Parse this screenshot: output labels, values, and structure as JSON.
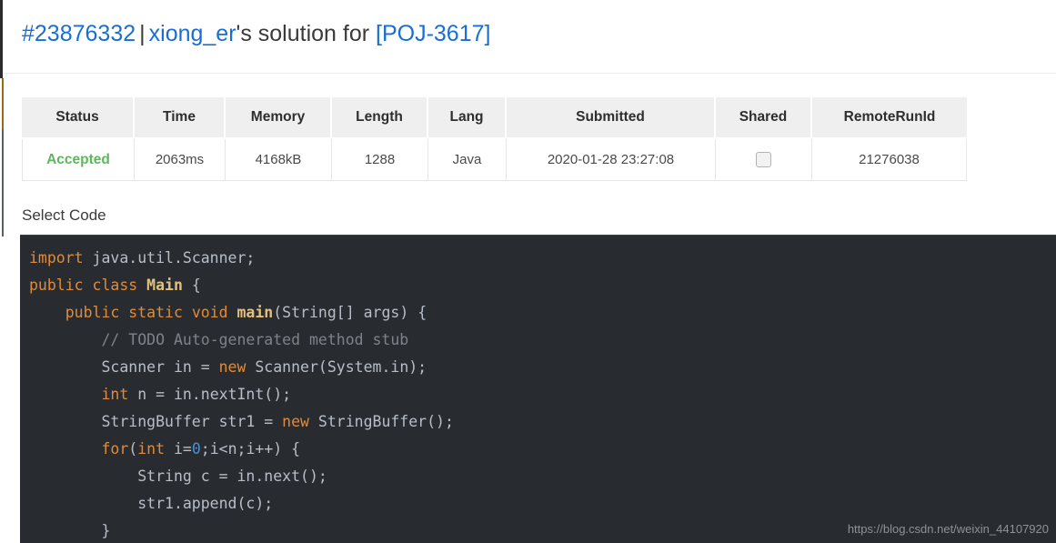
{
  "header": {
    "submission_id": "#23876332",
    "separator": "|",
    "username": "xiong_er",
    "possessive_text": "'s solution for",
    "problem_id": "[POJ-3617]"
  },
  "table": {
    "columns": [
      "Status",
      "Time",
      "Memory",
      "Length",
      "Lang",
      "Submitted",
      "Shared",
      "RemoteRunId"
    ],
    "rows": [
      {
        "status": "Accepted",
        "time": "2063ms",
        "memory": "4168kB",
        "length": "1288",
        "lang": "Java",
        "submitted": "2020-01-28 23:27:08",
        "shared": false,
        "remote_run_id": "21276038"
      }
    ]
  },
  "code_section": {
    "label": "Select Code",
    "language": "java",
    "lines": [
      "import java.util.Scanner;",
      "public class Main {",
      "    public static void main(String[] args) {",
      "        // TODO Auto-generated method stub",
      "        Scanner in = new Scanner(System.in);",
      "        int n = in.nextInt();",
      "        StringBuffer str1 = new StringBuffer();",
      "        for(int i=0;i<n;i++) {",
      "            String c = in.next();",
      "            str1.append(c);",
      "        }"
    ]
  },
  "watermark": {
    "text": "https://blog.csdn.net/weixin_44107920"
  },
  "colors": {
    "link": "#176ed6",
    "accepted": "#5cb85c",
    "code_background": "#282c30",
    "keyword": "#e08b3c",
    "class_name": "#e5c07b",
    "comment": "#7d838c",
    "number": "#4a8fd6",
    "code_text": "#b7bec9",
    "table_header_background": "#efefef"
  }
}
